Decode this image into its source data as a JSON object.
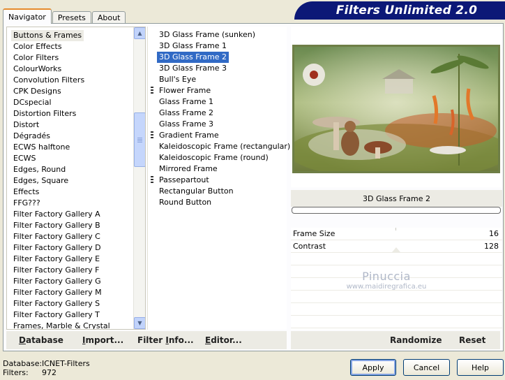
{
  "tabs": [
    "Navigator",
    "Presets",
    "About"
  ],
  "banner_title": "Filters Unlimited 2.0",
  "categories": [
    "Buttons & Frames",
    "Color Effects",
    "Color Filters",
    "ColourWorks",
    "Convolution Filters",
    "CPK Designs",
    "DCspecial",
    "Distortion Filters",
    "Distort",
    "Dégradés",
    "ECWS halftone",
    "ECWS",
    "Edges, Round",
    "Edges, Square",
    "Effects",
    "FFG???",
    "Filter Factory Gallery A",
    "Filter Factory Gallery B",
    "Filter Factory Gallery C",
    "Filter Factory Gallery D",
    "Filter Factory Gallery E",
    "Filter Factory Gallery F",
    "Filter Factory Gallery G",
    "Filter Factory Gallery M",
    "Filter Factory Gallery S",
    "Filter Factory Gallery T",
    "Frames, Marble & Crystal"
  ],
  "selected_category": 0,
  "filters": [
    {
      "name": "3D Glass Frame (sunken)",
      "sub": false
    },
    {
      "name": "3D Glass Frame 1",
      "sub": false
    },
    {
      "name": "3D Glass Frame 2",
      "sub": false
    },
    {
      "name": "3D Glass Frame 3",
      "sub": false
    },
    {
      "name": "Bull's Eye",
      "sub": false
    },
    {
      "name": "Flower Frame",
      "sub": true
    },
    {
      "name": "Glass Frame 1",
      "sub": false
    },
    {
      "name": "Glass Frame 2",
      "sub": false
    },
    {
      "name": "Glass Frame 3",
      "sub": false
    },
    {
      "name": "Gradient Frame",
      "sub": true
    },
    {
      "name": "Kaleidoscopic Frame (rectangular)",
      "sub": false
    },
    {
      "name": "Kaleidoscopic Frame (round)",
      "sub": false
    },
    {
      "name": "Mirrored Frame",
      "sub": false
    },
    {
      "name": "Passepartout",
      "sub": true
    },
    {
      "name": "Rectangular Button",
      "sub": false
    },
    {
      "name": "Round Button",
      "sub": false
    }
  ],
  "selected_filter": 2,
  "preview": {
    "filter_name": "3D Glass Frame 2"
  },
  "params": [
    {
      "label": "Frame Size",
      "value": "16"
    },
    {
      "label": "Contrast",
      "value": "128"
    }
  ],
  "watermark": {
    "line1": "Pinuccia",
    "line2": "www.maidiregrafica.eu"
  },
  "bottom_buttons": {
    "database": {
      "key": "D",
      "rest": "atabase"
    },
    "import": {
      "key": "I",
      "rest": "mport..."
    },
    "filter_info": {
      "pre": "Filter ",
      "key": "I",
      "rest": "nfo..."
    },
    "editor": {
      "key": "E",
      "rest": "ditor..."
    },
    "randomize": "Randomize",
    "reset": "Reset"
  },
  "status": {
    "database_label": "Database:",
    "database_value": "ICNET-Filters",
    "filters_label": "Filters:",
    "filters_value": "972"
  },
  "dialog_buttons": {
    "apply": "Apply",
    "cancel": "Cancel",
    "help": "Help"
  }
}
